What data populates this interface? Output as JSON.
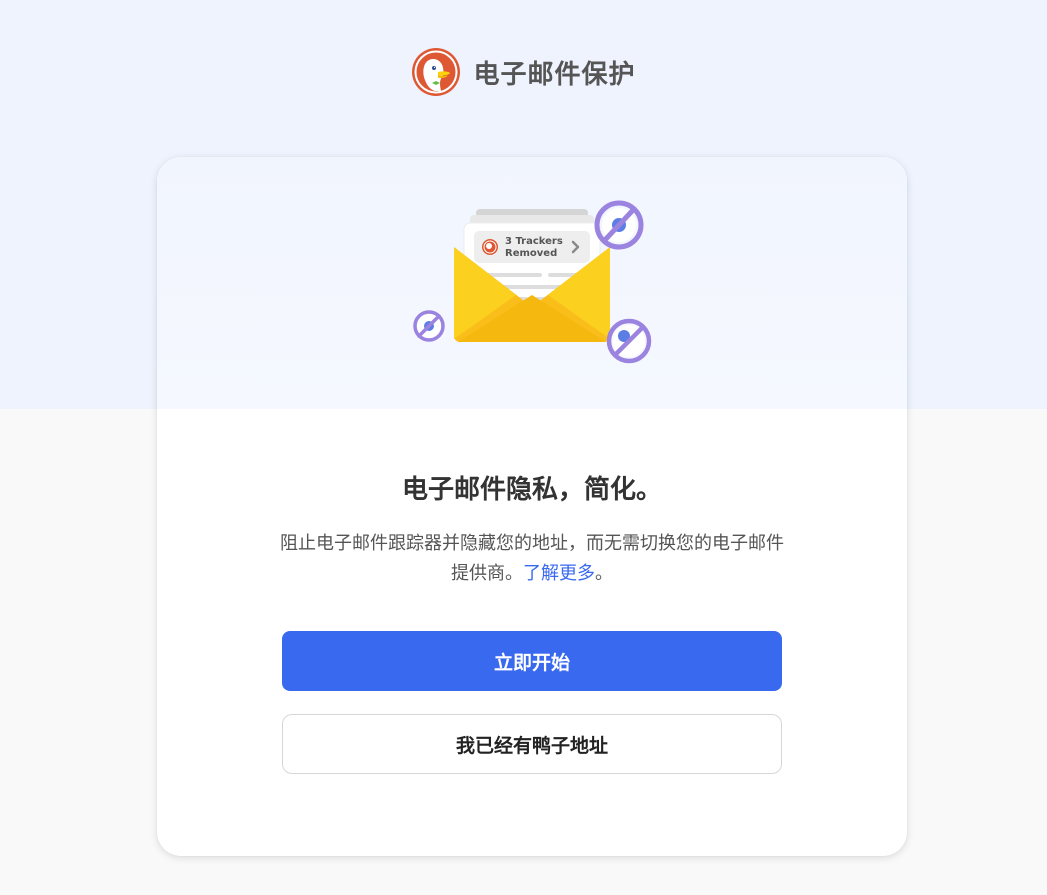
{
  "header": {
    "title": "电子邮件保护",
    "logo_icon": "duckduckgo-logo"
  },
  "illustration": {
    "badge_line1": "3 Trackers",
    "badge_line2": "Removed"
  },
  "card": {
    "headline": "电子邮件隐私，简化。",
    "description_before": "阻止电子邮件跟踪器并隐藏您的地址，而无需切换您的电子邮件提供商。",
    "learn_more": "了解更多",
    "description_after": "。",
    "primary_button": "立即开始",
    "secondary_button": "我已经有鸭子地址"
  },
  "colors": {
    "accent": "#3969ef",
    "page_background_top": "#eef3fe",
    "page_background_bottom": "#f9f9f9",
    "logo_orange": "#de5833",
    "envelope_yellow": "#f9be1a",
    "tracker_purple": "#9b83e0"
  }
}
